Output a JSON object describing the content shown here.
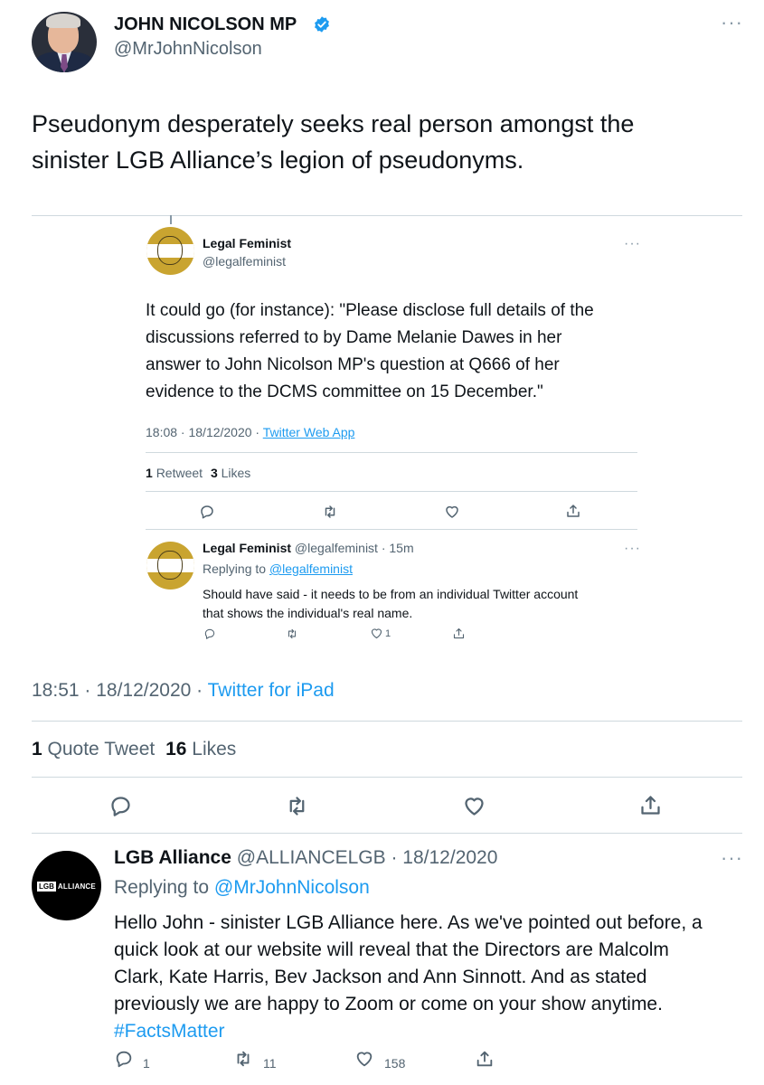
{
  "author": {
    "name": "JOHN NICOLSON MP",
    "handle": "@MrJohnNicolson"
  },
  "tweet": {
    "line1": "Pseudonym desperately seeks real person amongst the",
    "line2": "sinister LGB Alliance’s legion of pseudonyms."
  },
  "quoted": {
    "name": "Legal Feminist",
    "handle": "@legalfeminist",
    "lines": [
      "It could go (for instance): \"Please disclose full details of the",
      "discussions referred to by Dame Melanie Dawes in her",
      "answer to John Nicolson MP's question at Q666 of her",
      "evidence to the DCMS committee on 15 December.\""
    ],
    "timestamp": "18:08 · 18/12/2020 · ",
    "source": "Twitter Web App",
    "retweet_count": "1",
    "retweet_label": "Retweet",
    "like_count": "3",
    "like_label": "Likes",
    "reply": {
      "name": "Legal Feminist",
      "handle_time": "@legalfeminist · 15m",
      "replying_prefix": "Replying to ",
      "replying_handle": "@legalfeminist",
      "line1": "Should have said - it needs to be from an individual Twitter account",
      "line2": "that shows the individual's real name.",
      "like_count": "1"
    }
  },
  "meta": {
    "time": "18:51 · 18/12/2020 · ",
    "source": "Twitter for iPad"
  },
  "stats": {
    "quote_count": "1",
    "quote_label": "Quote Tweet",
    "like_count": "16",
    "like_label": "Likes"
  },
  "lgb_reply": {
    "avatar_text_boxed": "LGB",
    "avatar_text": "ALLIANCE",
    "name": "LGB Alliance",
    "handle_date": "@ALLIANCELGB · 18/12/2020",
    "replying_prefix": "Replying to ",
    "replying_handle": "@MrJohnNicolson",
    "lines": [
      "Hello John - sinister LGB Alliance here. As we've pointed out before, a",
      "quick look at our website will reveal that the Directors are Malcolm",
      "Clark, Kate Harris, Bev Jackson and Ann Sinnott. And as stated",
      "previously we are happy to Zoom or come on your show anytime."
    ],
    "hashtag": "#FactsMatter",
    "reply_count": "1",
    "retweet_count": "11",
    "like_count": "158"
  },
  "colors": {
    "link": "#1d9bf0",
    "secondary": "#536471",
    "divider": "#cfd9de",
    "verified": "#1d9bf0"
  },
  "icons": [
    "reply-icon",
    "retweet-icon",
    "like-icon",
    "share-icon",
    "more-icon",
    "verified-badge-icon"
  ]
}
